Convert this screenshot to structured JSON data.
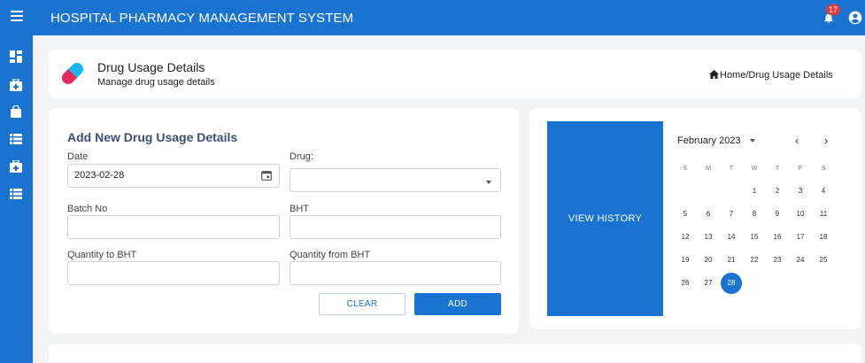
{
  "topbar": {
    "title": "HOSPITAL PHARMACY MANAGEMENT SYSTEM",
    "notification_count": "17",
    "icons": [
      "menu-icon",
      "bell-icon",
      "user-icon"
    ]
  },
  "sidebar": {
    "icons": [
      "dashboard-icon",
      "medical-bag-icon",
      "bag-icon",
      "list-icon",
      "medical-bag-icon",
      "list-icon"
    ]
  },
  "page_header": {
    "title": "Drug Usage Details",
    "subtitle": "Manage drug usage details",
    "breadcrumb": "Home/Drug Usage Details"
  },
  "form": {
    "title": "Add New Drug Usage Details",
    "date_label": "Date",
    "date_value": "2023-02-28",
    "drug_label": "Drug:",
    "drug_value": "",
    "batch_label": "Batch No",
    "batch_value": "",
    "bht_label": "BHT",
    "bht_value": "",
    "qty_to_label": "Quantity to BHT",
    "qty_to_value": "",
    "qty_from_label": "Quantity from BHT",
    "qty_from_value": "",
    "clear_label": "CLEAR",
    "add_label": "ADD"
  },
  "view_history_label": "VIEW HISTORY",
  "calendar": {
    "month_label": "February 2023",
    "prev": "‹",
    "next": "›",
    "weekdays": [
      "S",
      "M",
      "T",
      "W",
      "T",
      "F",
      "S"
    ],
    "days": [
      "",
      "",
      "",
      "1",
      "2",
      "3",
      "4",
      "5",
      "6",
      "7",
      "8",
      "9",
      "10",
      "11",
      "12",
      "13",
      "14",
      "15",
      "16",
      "17",
      "18",
      "19",
      "20",
      "21",
      "22",
      "23",
      "24",
      "25",
      "26",
      "27",
      "28"
    ],
    "selected_day": "28"
  },
  "colors": {
    "primary": "#1a73d1",
    "badge": "#e53935",
    "form_title": "#3d4f73"
  }
}
